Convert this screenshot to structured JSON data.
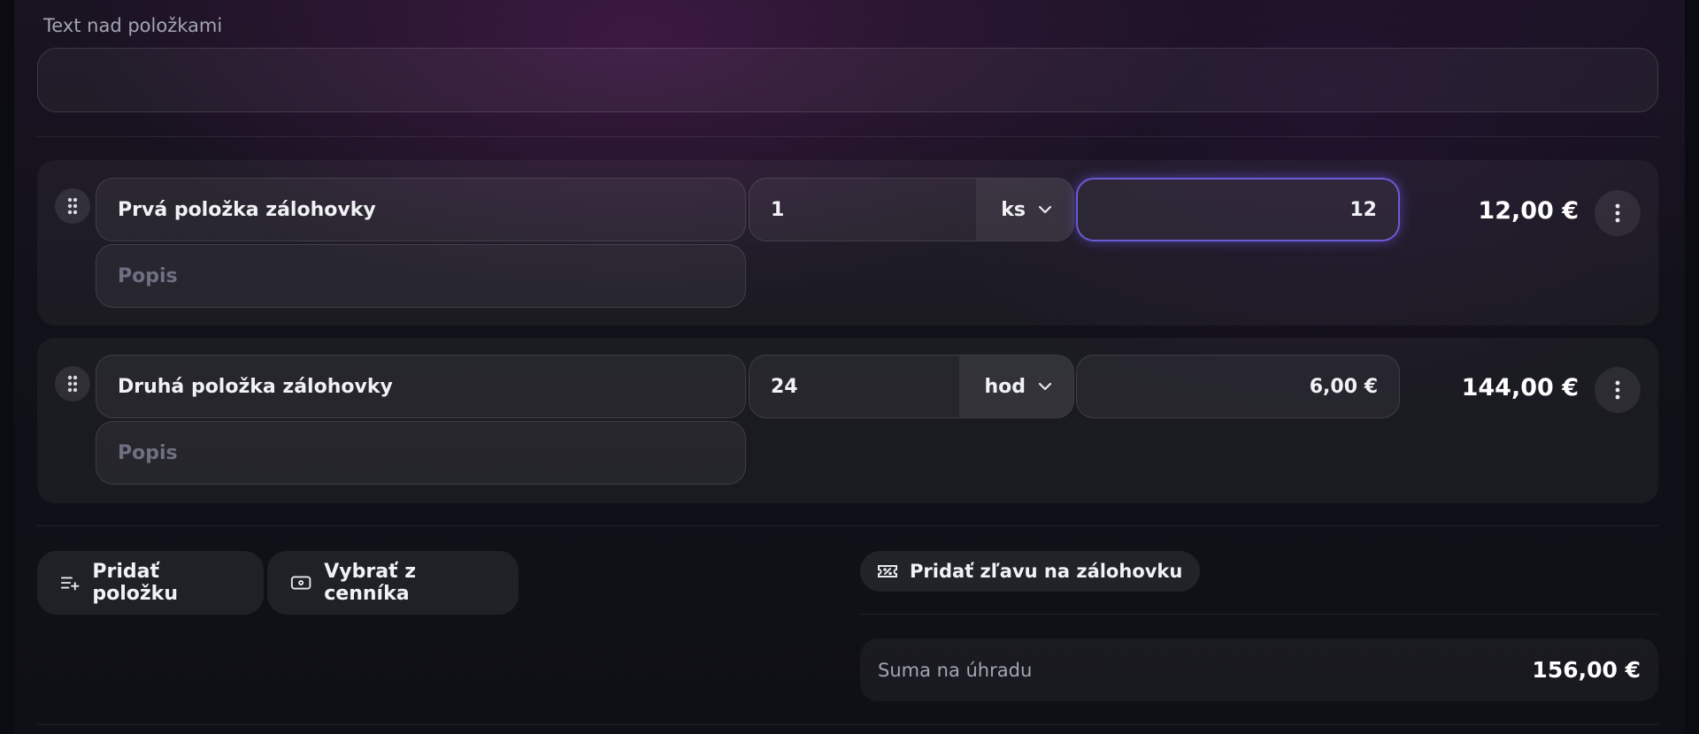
{
  "header": {
    "label": "Text nad položkami",
    "input_value": ""
  },
  "items": [
    {
      "name": "Prvá položka zálohovky",
      "description_placeholder": "Popis",
      "quantity": "1",
      "unit": "ks",
      "price": "12",
      "total": "12,00 €"
    },
    {
      "name": "Druhá položka zálohovky",
      "description_placeholder": "Popis",
      "quantity": "24",
      "unit": "hod",
      "price": "6,00 €",
      "total": "144,00 €"
    }
  ],
  "actions": {
    "add_item": "Pridať položku",
    "pick_from_pricelist": "Vybrať z cenníka",
    "add_discount": "Pridať zľavu na zálohovku"
  },
  "summary": {
    "label": "Suma na úhradu",
    "value": "156,00 €"
  },
  "colors": {
    "focus_accent": "#6a5bd6",
    "background": "#111119"
  },
  "icons": [
    "drag-handle-icon",
    "chevron-down-icon",
    "more-vertical-icon",
    "add-list-icon",
    "pricelist-icon",
    "discount-ticket-icon"
  ]
}
